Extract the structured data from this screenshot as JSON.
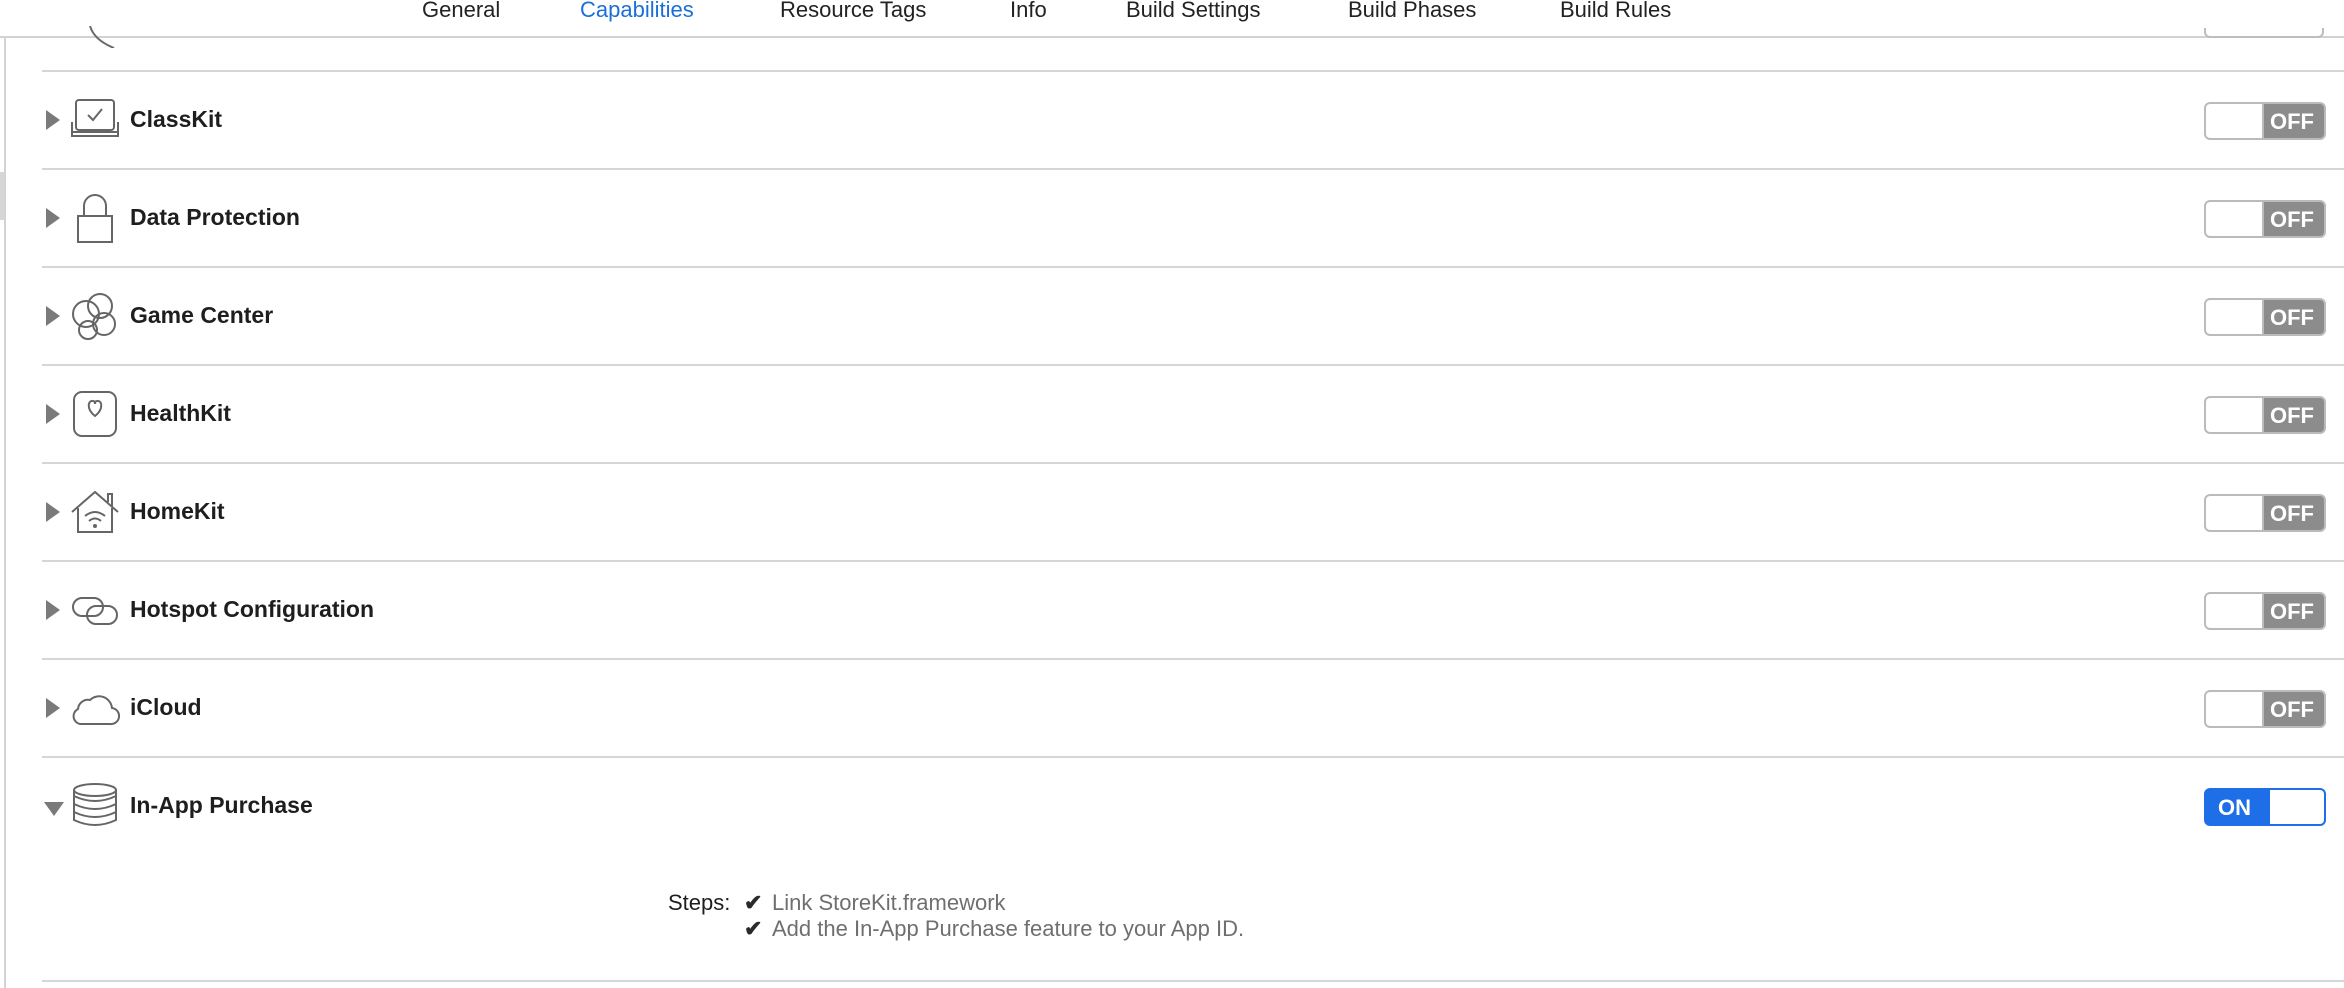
{
  "tabs": [
    {
      "label": "General",
      "active": false
    },
    {
      "label": "Capabilities",
      "active": true
    },
    {
      "label": "Resource Tags",
      "active": false
    },
    {
      "label": "Info",
      "active": false
    },
    {
      "label": "Build Settings",
      "active": false
    },
    {
      "label": "Build Phases",
      "active": false
    },
    {
      "label": "Build Rules",
      "active": false
    }
  ],
  "capabilities": [
    {
      "label": "ClassKit",
      "icon": "classkit-icon",
      "state": "OFF",
      "expanded": false
    },
    {
      "label": "Data Protection",
      "icon": "lock-icon",
      "state": "OFF",
      "expanded": false
    },
    {
      "label": "Game Center",
      "icon": "game-center-icon",
      "state": "OFF",
      "expanded": false
    },
    {
      "label": "HealthKit",
      "icon": "heart-icon",
      "state": "OFF",
      "expanded": false
    },
    {
      "label": "HomeKit",
      "icon": "home-icon",
      "state": "OFF",
      "expanded": false
    },
    {
      "label": "Hotspot Configuration",
      "icon": "hotspot-icon",
      "state": "OFF",
      "expanded": false
    },
    {
      "label": "iCloud",
      "icon": "cloud-icon",
      "state": "OFF",
      "expanded": false
    },
    {
      "label": "In-App Purchase",
      "icon": "coins-icon",
      "state": "ON",
      "expanded": true
    }
  ],
  "in_app_purchase": {
    "steps_label": "Steps:",
    "steps": [
      {
        "check": "✔",
        "text": "Link StoreKit.framework"
      },
      {
        "check": "✔",
        "text": "Add the In-App Purchase feature to your App ID."
      }
    ]
  },
  "colors": {
    "accent": "#1a6fd8",
    "switch_on": "#1e6ee8",
    "switch_off": "#8c8c8c",
    "divider": "#d6d6d6"
  }
}
